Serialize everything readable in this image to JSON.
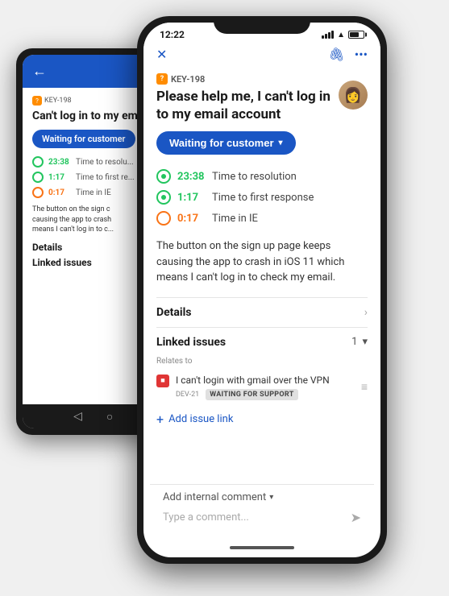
{
  "scene": {
    "background": "#f0f0f0"
  },
  "back_phone": {
    "key": "KEY-198",
    "title": "Can't log in to my em...",
    "status": "Waiting for customer",
    "timers": [
      {
        "value": "23:38",
        "label": "Time to resolu...",
        "color": "green"
      },
      {
        "value": "1:17",
        "label": "Time to first re...",
        "color": "green"
      },
      {
        "value": "0:17",
        "label": "Time in IE",
        "color": "orange"
      }
    ],
    "description": "The button on the sign c... causing the app to crash... means I can't log in to c...",
    "details_title": "Details",
    "linked_title": "Linked issues"
  },
  "front_phone": {
    "status_bar": {
      "time": "12:22",
      "location_icon": "▲"
    },
    "toolbar": {
      "close_label": "✕",
      "attach_label": "📎",
      "more_label": "•••"
    },
    "issue": {
      "key": "KEY-198",
      "title": "Please help me, I can't log in to my email account",
      "status": "Waiting for customer",
      "timers": [
        {
          "value": "23:38",
          "label": "Time to resolution",
          "color": "green"
        },
        {
          "value": "1:17",
          "label": "Time to first response",
          "color": "green"
        },
        {
          "value": "0:17",
          "label": "Time in IE",
          "color": "orange"
        }
      ],
      "description": "The button on the sign up page keeps causing the app to crash in iOS 11 which means I can't log in to check my email.",
      "details_title": "Details",
      "linked_title": "Linked issues",
      "linked_count": "1",
      "relates_to": "Relates to",
      "linked_item": {
        "text": "I can't login with gmail over the VPN",
        "dev_key": "DEV-21",
        "badge": "WAITING FOR SUPPORT"
      },
      "add_link": "Add issue link",
      "comment_section": "Add internal comment",
      "comment_placeholder": "Type a comment..."
    }
  }
}
